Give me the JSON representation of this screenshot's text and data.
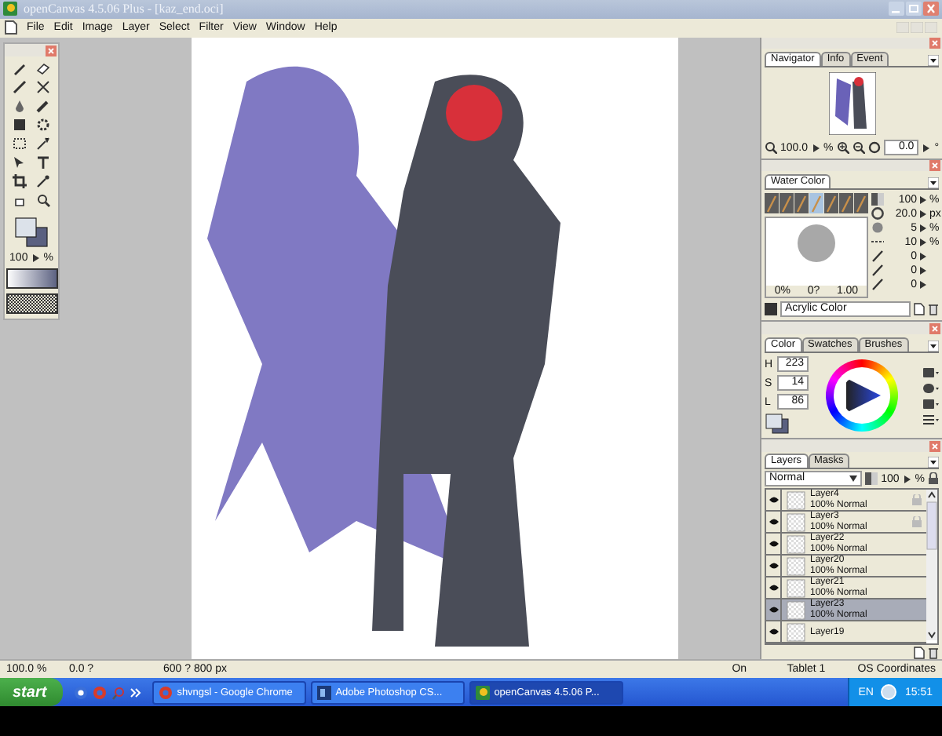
{
  "window": {
    "title": "openCanvas 4.5.06 Plus - [kaz_end.oci]"
  },
  "menu": [
    "File",
    "Edit",
    "Image",
    "Layer",
    "Select",
    "Filter",
    "View",
    "Window",
    "Help"
  ],
  "toolbox": {
    "zoom": "100",
    "unit": "%"
  },
  "navigator": {
    "tabs": [
      {
        "label": "Navigator",
        "selected": true
      },
      {
        "label": "Info",
        "selected": false
      },
      {
        "label": "Event",
        "selected": false
      }
    ],
    "zoom": "100.0",
    "unit": "%",
    "angle": "0.0",
    "angle_unit": "°"
  },
  "brush": {
    "tabs": [
      {
        "label": "Water Color",
        "selected": true
      }
    ],
    "settings": [
      {
        "value": "100",
        "unit": "%"
      },
      {
        "value": "20.0",
        "unit": "px"
      },
      {
        "value": "5",
        "unit": "%"
      },
      {
        "value": "10",
        "unit": "%"
      },
      {
        "value": "0"
      },
      {
        "value": "0"
      },
      {
        "value": "0"
      }
    ],
    "readouts": [
      "0%",
      "0?",
      "1.00"
    ],
    "preset": "Acrylic Color"
  },
  "color": {
    "tabs": [
      {
        "label": "Color",
        "selected": true
      },
      {
        "label": "Swatches",
        "selected": false
      },
      {
        "label": "Brushes",
        "selected": false
      }
    ],
    "fields": [
      {
        "label": "H",
        "value": "223"
      },
      {
        "label": "S",
        "value": "14"
      },
      {
        "label": "L",
        "value": "86"
      }
    ]
  },
  "layers": {
    "tabs": [
      {
        "label": "Layers",
        "selected": true
      },
      {
        "label": "Masks",
        "selected": false
      }
    ],
    "blend_mode": "Normal",
    "opacity": "100",
    "unit": "%",
    "items": [
      {
        "name": "Layer4",
        "info": "100% Normal",
        "visible": true,
        "selected": false,
        "locked": true
      },
      {
        "name": "Layer3",
        "info": "100% Normal",
        "visible": true,
        "selected": false,
        "locked": true
      },
      {
        "name": "Layer22",
        "info": "100% Normal",
        "visible": true,
        "selected": false,
        "locked": false
      },
      {
        "name": "Layer20",
        "info": "100% Normal",
        "visible": true,
        "selected": false,
        "locked": false
      },
      {
        "name": "Layer21",
        "info": "100% Normal",
        "visible": true,
        "selected": false,
        "locked": false
      },
      {
        "name": "Layer23",
        "info": "100% Normal",
        "visible": true,
        "selected": true,
        "locked": false
      },
      {
        "name": "Layer19",
        "visible": true,
        "selected": false,
        "locked": false
      }
    ]
  },
  "status_bar": [
    "100.0 %",
    "0.0 ?",
    "600 ? 800 px",
    "On",
    "Tablet 1",
    "OS Coordinates"
  ],
  "taskbar": {
    "start": "start",
    "tasks": [
      {
        "label": "shvngsl - Google Chrome",
        "selected": false
      },
      {
        "label": "Adobe Photoshop CS...",
        "selected": false
      },
      {
        "label": "openCanvas 4.5.06 P...",
        "selected": true
      }
    ],
    "language": "EN",
    "clock": "15:51"
  }
}
